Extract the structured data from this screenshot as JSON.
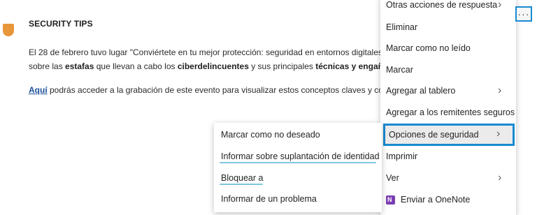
{
  "email": {
    "title": "SECURITY TIPS",
    "p1_line1": "El 28 de febrero tuvo lugar \"Conviértete en tu mejor protección: seguridad en entornos digitales\". En ev",
    "p1_line2_a": "sobre las ",
    "p1_line2_b": "estafas",
    "p1_line2_c": " que llevan a cabo los ",
    "p1_line2_d": "ciberdelincuentes",
    "p1_line2_e": " y sus principales ",
    "p1_line2_f": "técnicas y engaños de i",
    "p2_link": "Aquí",
    "p2_text": " podrás acceder a la grabación de este evento para visualizar estos conceptos claves y continuar s"
  },
  "main_menu": {
    "items": [
      {
        "label": "Otras acciones de respuesta"
      },
      {
        "label": "Eliminar"
      },
      {
        "label": "Marcar como no leído"
      },
      {
        "label": "Marcar"
      },
      {
        "label": "Agregar al tablero"
      },
      {
        "label": "Agregar a los remitentes seguros"
      },
      {
        "label": "Opciones de seguridad"
      },
      {
        "label": "Imprimir"
      },
      {
        "label": "Ver"
      },
      {
        "label": "Enviar a OneNote"
      }
    ]
  },
  "sub_menu": {
    "items": [
      {
        "label": "Marcar como no deseado"
      },
      {
        "label": "Informar sobre suplantación de identidad"
      },
      {
        "label": "Bloquear a"
      },
      {
        "label": "Informar de un problema"
      }
    ]
  },
  "more_button": {
    "label": "···"
  },
  "colors": {
    "highlight": "#1a8ad1",
    "underline": "#7ec8dd",
    "onenote": "#7b3fb3",
    "shield": "#e8963a"
  },
  "icons": [
    "shield-icon",
    "chevron-right-icon",
    "onenote-icon",
    "more-icon"
  ]
}
